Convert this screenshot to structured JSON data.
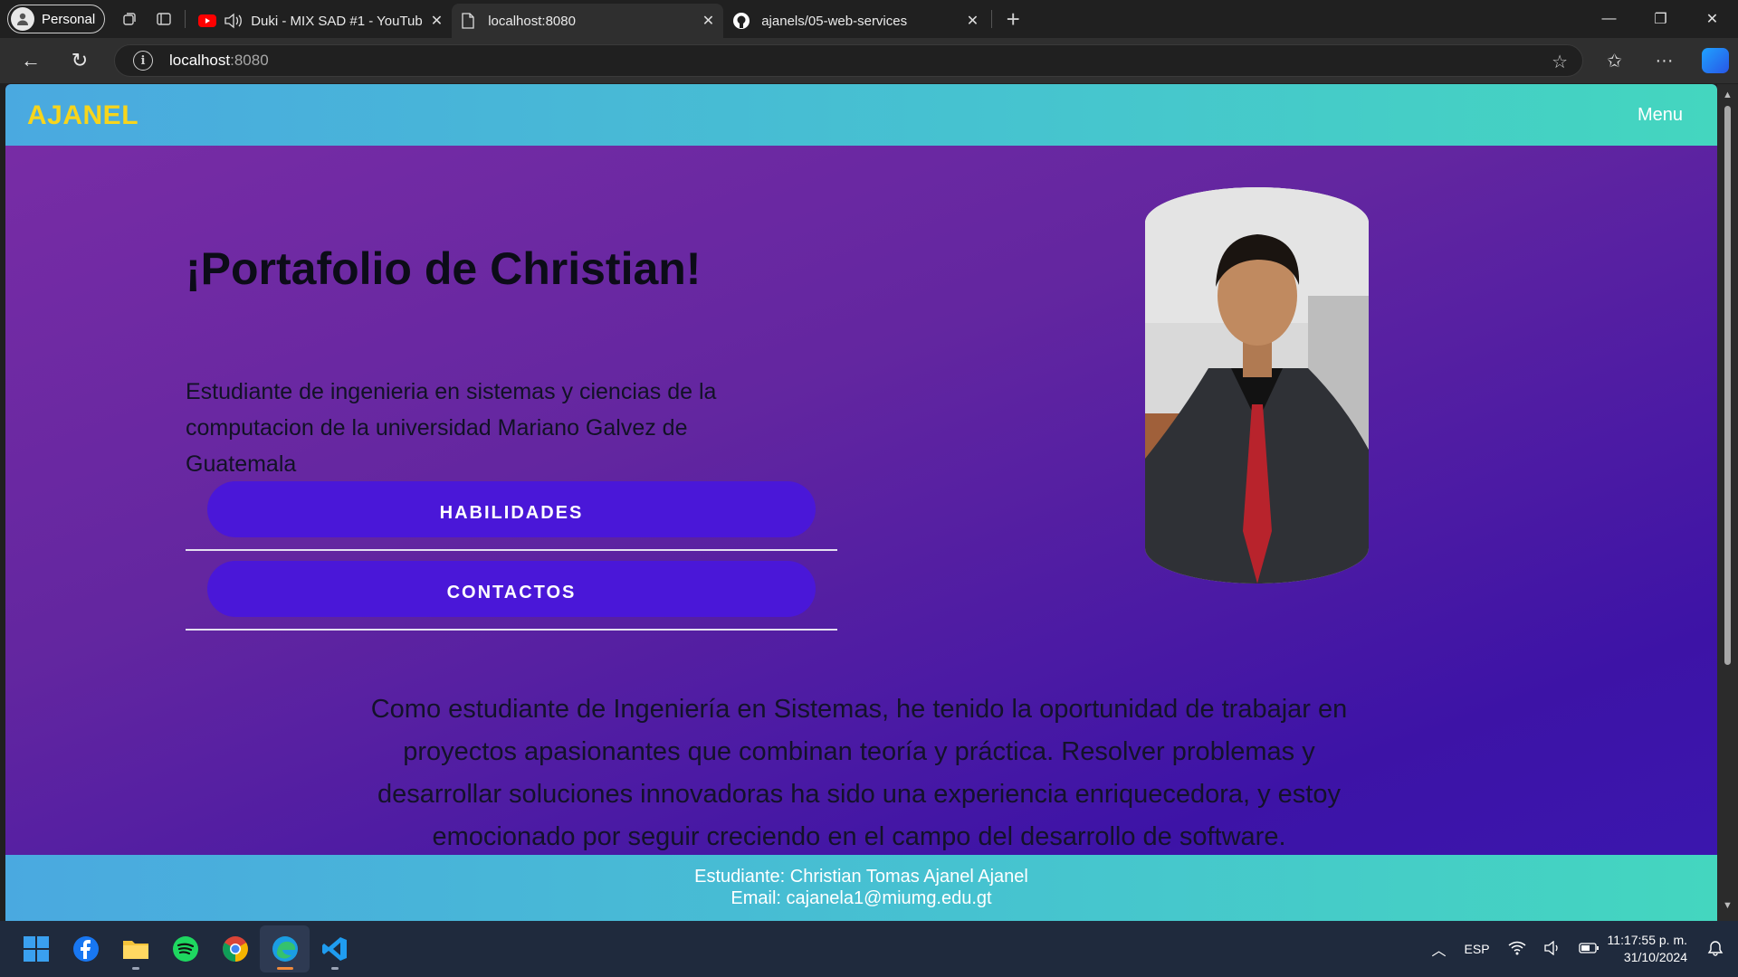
{
  "browser": {
    "profile_label": "Personal",
    "tabs": [
      {
        "title": "Duki - MIX SAD #1 - YouTube"
      },
      {
        "title": "localhost:8080"
      },
      {
        "title": "ajanels/05-web-services"
      }
    ],
    "address": {
      "host": "localhost",
      "port": ":8080"
    }
  },
  "site": {
    "brand": "AJANEL",
    "menu_label": "Menu",
    "hero_title": "¡Portafolio de Christian!",
    "hero_description": "Estudiante de ingenieria en sistemas y ciencias de la computacion de la universidad Mariano Galvez de Guatemala",
    "buttons": {
      "skills": "HABILIDADES",
      "contacts": "CONTACTOS"
    },
    "about": "Como estudiante de Ingeniería en Sistemas, he tenido la oportunidad de trabajar en proyectos apasionantes que combinan teoría y práctica. Resolver problemas y desarrollar soluciones innovadoras ha sido una experiencia enriquecedora, y estoy emocionado por seguir creciendo en el campo del desarrollo de software.",
    "footer": {
      "student": "Estudiante: Christian Tomas Ajanel Ajanel",
      "email": "Email: cajanela1@miumg.edu.gt"
    },
    "colors": {
      "brand": "#f7d51c",
      "button": "#4a17d8",
      "header_start": "#4aa9e0",
      "header_end": "#44d6bf"
    }
  },
  "taskbar": {
    "apps": [
      "windows-start",
      "facebook",
      "file-explorer",
      "spotify",
      "chrome",
      "edge",
      "vscode"
    ],
    "language": "ESP",
    "time": "11:17:55 p. m.",
    "date": "31/10/2024"
  }
}
